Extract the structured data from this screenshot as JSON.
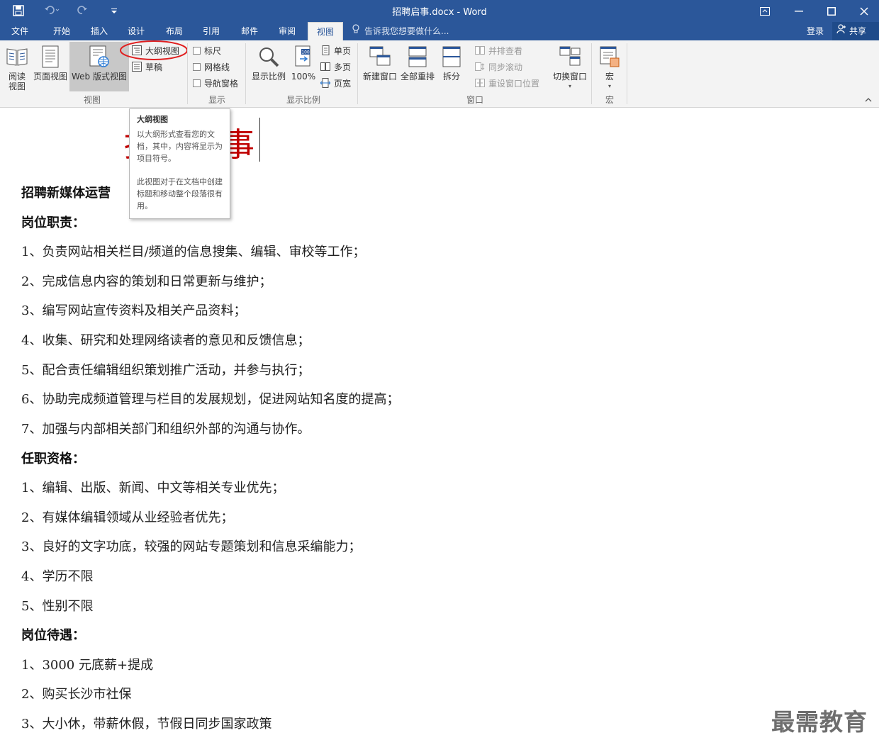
{
  "window": {
    "title": "招聘启事.docx - Word",
    "buttons": [
      "ribbon-display",
      "minimize",
      "maximize",
      "close"
    ]
  },
  "tabs": [
    "文件",
    "开始",
    "插入",
    "设计",
    "布局",
    "引用",
    "邮件",
    "审阅",
    "视图"
  ],
  "active_tab": "视图",
  "tell_me": "告诉我您想要做什么...",
  "account": {
    "login": "登录",
    "share": "共享"
  },
  "ribbon": {
    "groups": {
      "views": "视图",
      "show": "显示",
      "zoom": "显示比例",
      "window": "窗口",
      "macros": "宏"
    },
    "views": {
      "read_mode_line1": "阅读",
      "read_mode_line2": "视图",
      "print_layout": "页面视图",
      "web_layout": "Web 版式视图",
      "outline": "大纲视图",
      "draft": "草稿"
    },
    "show": {
      "ruler": "标尺",
      "gridlines": "网格线",
      "nav_pane": "导航窗格"
    },
    "zoom": {
      "zoom": "显示比例",
      "hundred": "100%",
      "one_page": "单页",
      "multi_page": "多页",
      "page_width": "页宽"
    },
    "window": {
      "new_window": "新建窗口",
      "arrange_all": "全部重排",
      "split": "拆分",
      "side_by_side": "并排查看",
      "sync_scroll": "同步滚动",
      "reset_position": "重设窗口位置",
      "switch_windows": "切换窗口"
    },
    "macros": {
      "macros": "宏"
    }
  },
  "tooltip": {
    "title": "大纲视图",
    "para1": "以大纲形式查看您的文档，其中，内容将显示为项目符号。",
    "para2": "此视图对于在文档中创建标题和移动整个段落很有用。"
  },
  "document": {
    "title_visible": "事",
    "title_partial": "招聘启事",
    "job_title": "招聘新媒体运营",
    "sections": [
      {
        "heading": "岗位职责：",
        "items": [
          "1、负责网站相关栏目/频道的信息搜集、编辑、审校等工作；",
          "2、完成信息内容的策划和日常更新与维护；",
          "3、编写网站宣传资料及相关产品资料；",
          "4、收集、研究和处理网络读者的意见和反馈信息；",
          "5、配合责任编辑组织策划推广活动，并参与执行；",
          "6、协助完成频道管理与栏目的发展规划，促进网站知名度的提高；",
          "7、加强与内部相关部门和组织外部的沟通与协作。"
        ]
      },
      {
        "heading": "任职资格：",
        "items": [
          "1、编辑、出版、新闻、中文等相关专业优先；",
          "2、有媒体编辑领域从业经验者优先；",
          "3、良好的文字功底，较强的网站专题策划和信息采编能力；",
          "4、学历不限",
          "5、性别不限"
        ]
      },
      {
        "heading": "岗位待遇：",
        "items": [
          "1、3000 元底薪+提成",
          "2、购买长沙市社保",
          "3、大小休，带薪休假，节假日同步国家政策"
        ]
      }
    ]
  },
  "watermark": "最需教育",
  "colors": {
    "titlebar": "#2b579a",
    "ribbon": "#f3f3f3",
    "title_red": "#c00000",
    "highlight_circle": "#e02020"
  }
}
